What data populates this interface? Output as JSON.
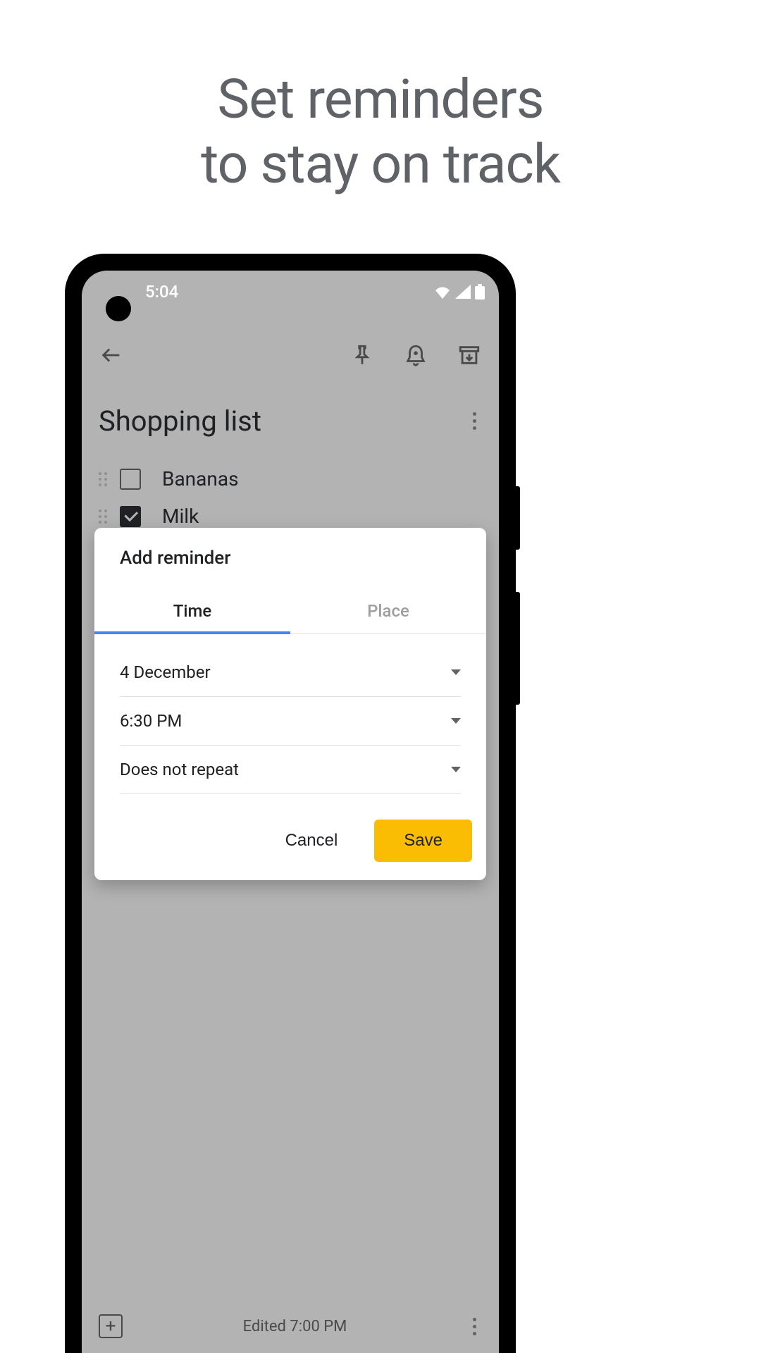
{
  "hero": {
    "line1": "Set reminders",
    "line2": "to stay on track"
  },
  "status": {
    "time": "5:04"
  },
  "note": {
    "title": "Shopping list",
    "items": [
      {
        "label": "Bananas",
        "checked": false
      },
      {
        "label": "Milk",
        "checked": true
      }
    ]
  },
  "dialog": {
    "title": "Add reminder",
    "tabs": {
      "time": "Time",
      "place": "Place"
    },
    "fields": {
      "date": "4 December",
      "time": "6:30 PM",
      "repeat": "Does not repeat"
    },
    "actions": {
      "cancel": "Cancel",
      "save": "Save"
    }
  },
  "bottom": {
    "edited": "Edited 7:00 PM"
  }
}
